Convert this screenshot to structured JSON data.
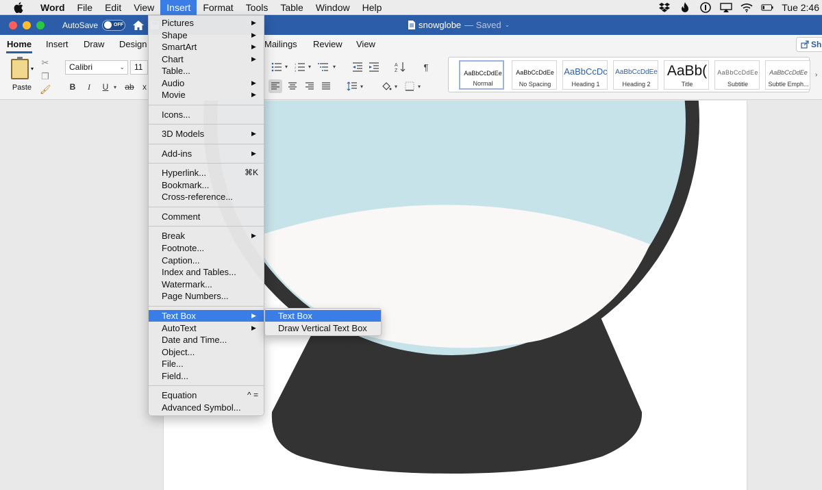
{
  "menubar": {
    "app_name": "Word",
    "items": [
      "File",
      "Edit",
      "View",
      "Insert",
      "Format",
      "Tools",
      "Table",
      "Window",
      "Help"
    ],
    "active_item": "Insert",
    "clock": "Tue 2:46"
  },
  "window": {
    "autosave_label": "AutoSave",
    "autosave_state": "OFF",
    "doc_name": "snowglobe",
    "doc_status": "— Saved"
  },
  "ribbon": {
    "tabs": [
      "Home",
      "Insert",
      "Draw",
      "Design",
      "Mailings",
      "Review",
      "View"
    ],
    "active_tab": "Home",
    "share_label": "Sh",
    "paste_label": "Paste",
    "font_name": "Calibri",
    "font_size": "11",
    "format_buttons": [
      "B",
      "I",
      "U",
      "ab",
      "x"
    ],
    "pilcrow": "¶",
    "styles": [
      {
        "sample": "AaBbCcDdEe",
        "name": "Normal"
      },
      {
        "sample": "AaBbCcDdEe",
        "name": "No Spacing"
      },
      {
        "sample": "AaBbCcDc",
        "name": "Heading 1"
      },
      {
        "sample": "AaBbCcDdEe",
        "name": "Heading 2"
      },
      {
        "sample": "AaBb(",
        "name": "Title"
      },
      {
        "sample": "AaBbCcDdEe",
        "name": "Subtitle"
      },
      {
        "sample": "AaBbCcDdEe",
        "name": "Subtle Emph..."
      }
    ]
  },
  "insert_menu": {
    "items": [
      {
        "label": "Pictures",
        "submenu": true
      },
      {
        "label": "Shape",
        "submenu": true
      },
      {
        "label": "SmartArt",
        "submenu": true
      },
      {
        "label": "Chart",
        "submenu": true
      },
      {
        "label": "Table...",
        "submenu": false
      },
      {
        "label": "Audio",
        "submenu": true
      },
      {
        "label": "Movie",
        "submenu": true
      },
      {
        "label": "Icons...",
        "submenu": false
      },
      {
        "label": "3D Models",
        "submenu": true
      },
      {
        "label": "Add-ins",
        "submenu": true
      },
      {
        "label": "Hyperlink...",
        "submenu": false,
        "shortcut": "⌘K"
      },
      {
        "label": "Bookmark...",
        "submenu": false
      },
      {
        "label": "Cross-reference...",
        "submenu": false
      },
      {
        "label": "Comment",
        "submenu": false
      },
      {
        "label": "Break",
        "submenu": true
      },
      {
        "label": "Footnote...",
        "submenu": false
      },
      {
        "label": "Caption...",
        "submenu": false
      },
      {
        "label": "Index and Tables...",
        "submenu": false
      },
      {
        "label": "Watermark...",
        "submenu": false
      },
      {
        "label": "Page Numbers...",
        "submenu": false
      },
      {
        "label": "Text Box",
        "submenu": true,
        "highlighted": true
      },
      {
        "label": "AutoText",
        "submenu": true
      },
      {
        "label": "Date and Time...",
        "submenu": false
      },
      {
        "label": "Object...",
        "submenu": false
      },
      {
        "label": "File...",
        "submenu": false
      },
      {
        "label": "Field...",
        "submenu": false
      },
      {
        "label": "Equation",
        "submenu": false,
        "shortcut": "^ ="
      },
      {
        "label": "Advanced Symbol...",
        "submenu": false
      }
    ]
  },
  "textbox_submenu": {
    "items": [
      {
        "label": "Text Box",
        "highlighted": true
      },
      {
        "label": "Draw Vertical Text Box",
        "highlighted": false
      }
    ]
  },
  "colors": {
    "accent": "#3b7de6",
    "titlebar": "#2c5da8",
    "globe_sky": "#c7e3ea",
    "globe_snow": "#f9f8f6",
    "globe_dark": "#333333"
  }
}
